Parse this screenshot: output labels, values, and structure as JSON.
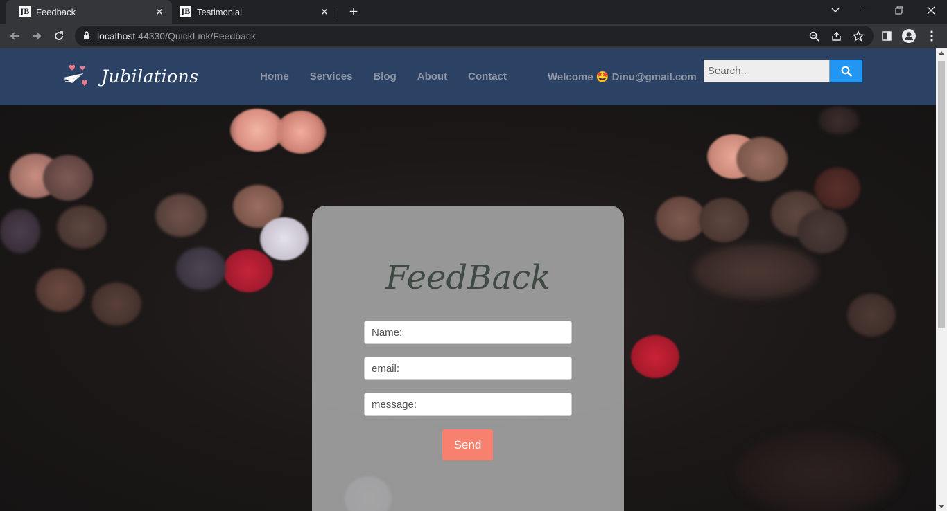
{
  "browser": {
    "tabs": [
      {
        "favicon": "JB",
        "title": "Feedback",
        "active": true
      },
      {
        "favicon": "JB",
        "title": "Testimonial",
        "active": false
      }
    ],
    "url_host": "localhost",
    "url_rest": ":44330/QuickLink/Feedback"
  },
  "site": {
    "brand": "Jubilations",
    "nav": [
      "Home",
      "Services",
      "Blog",
      "About",
      "Contact"
    ],
    "welcome_prefix": "Welcome",
    "welcome_emoji": "🤩",
    "welcome_user": "Dinu@gmail.com",
    "search_placeholder": "Search.."
  },
  "feedback": {
    "title": "FeedBack",
    "name_placeholder": "Name:",
    "email_placeholder": "email:",
    "message_placeholder": "message:",
    "send_label": "Send"
  },
  "colors": {
    "header_bg": "#2c4265",
    "search_button": "#2196f3",
    "send_button": "#f7806e",
    "card_bg": "#a0a0a0"
  }
}
